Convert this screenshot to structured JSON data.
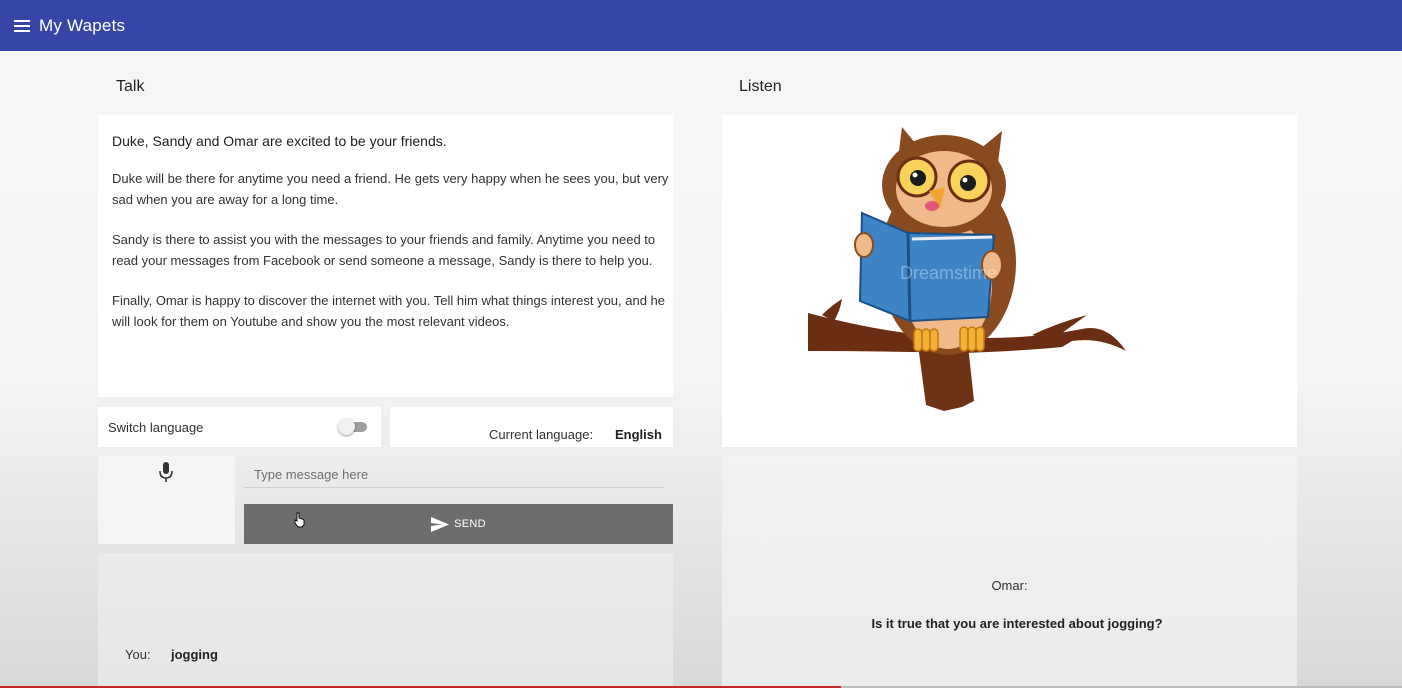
{
  "appbar": {
    "title": "My Wapets",
    "menu_icon": "menu-icon"
  },
  "talk": {
    "section_title": "Talk",
    "intro": "Duke, Sandy and Omar are excited to be your friends.",
    "paragraphs": [
      "Duke will be there for anytime you need a friend. He gets very happy when he sees you, but very sad when you are away for a long time.",
      "Sandy is there to assist you with the messages to your friends and family. Anytime you need to read your messages from Facebook or send someone a message, Sandy is there to help you.",
      "Finally, Omar is happy to discover the internet with you. Tell him what things interest you, and he will look for them on Youtube and show you the most relevant videos."
    ],
    "switch_language_label": "Switch language",
    "switch_language_on": false,
    "current_language_label": "Current language:",
    "current_language_value": "English",
    "mic_icon": "microphone-icon",
    "message_placeholder": "Type message here",
    "message_value": "",
    "send_label": "SEND",
    "send_icon": "send-icon",
    "you_label": "You:",
    "you_value": "jogging"
  },
  "listen": {
    "section_title": "Listen",
    "image": "owl-reading-book-illustration",
    "watermark": "Dreamstime",
    "speaker": "Omar:",
    "message": "Is it true that you are interested about jogging?"
  },
  "colors": {
    "appbar": "#3746a6",
    "send_button": "#6d6d6d",
    "owl_body": "#8a4a1f",
    "book": "#3d84c6"
  }
}
